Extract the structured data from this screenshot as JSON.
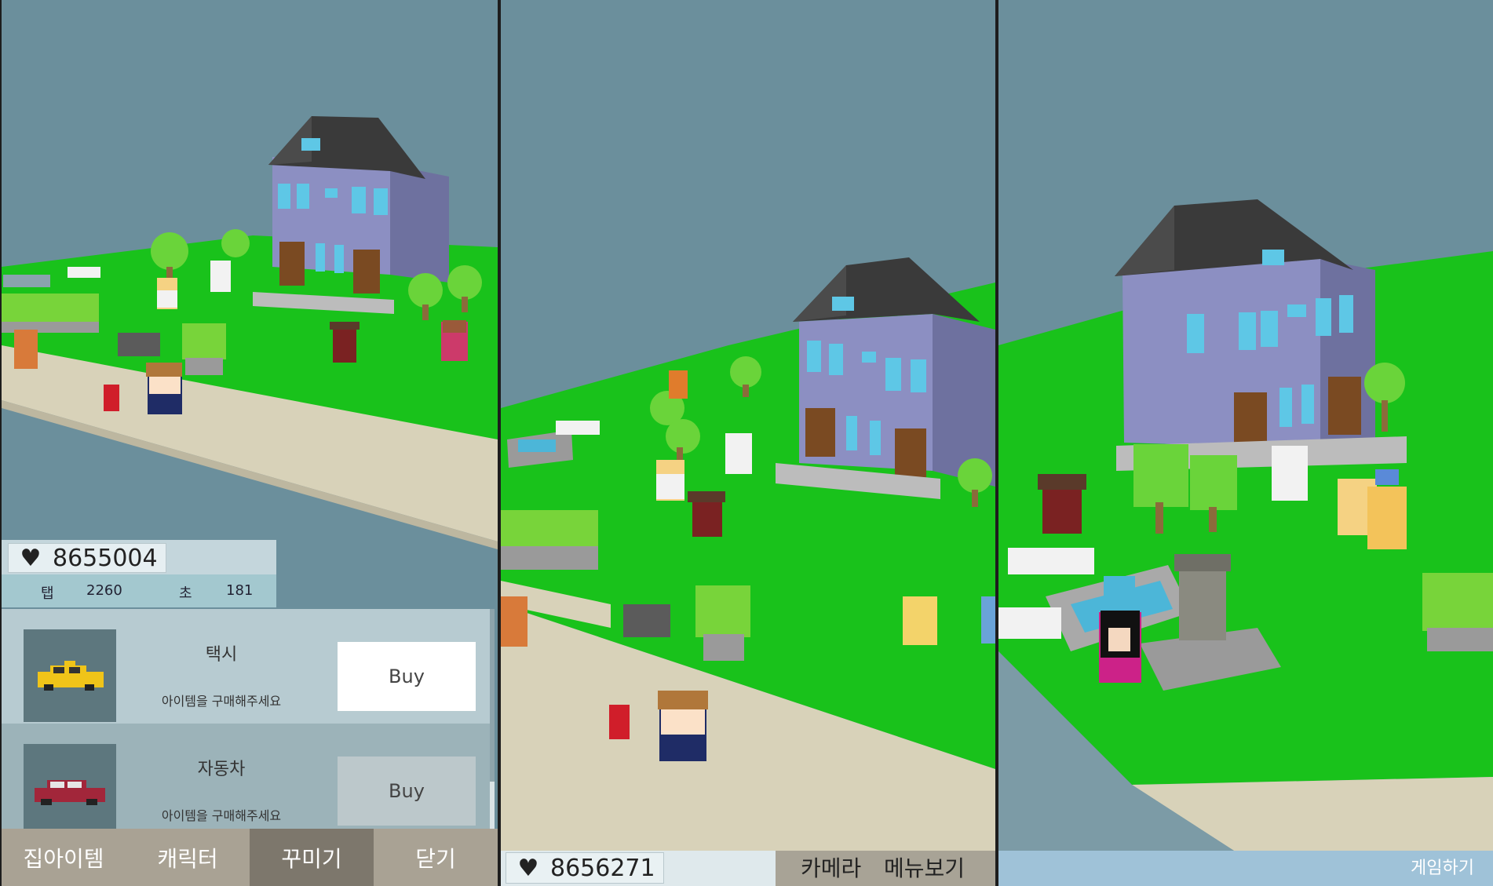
{
  "panel1": {
    "hearts": "8655004",
    "heart_icon": "♥",
    "stats": {
      "tap_label": "탭",
      "tap_value": "2260",
      "sec_label": "초",
      "sec_value": "181"
    },
    "shop_items": [
      {
        "name": "택시",
        "desc": "아이템을 구매해주세요",
        "buy": "Buy",
        "icon": "taxi-icon"
      },
      {
        "name": "자동차",
        "desc": "아이템을 구매해주세요",
        "buy": "Buy",
        "icon": "car-icon"
      }
    ],
    "tabs": [
      {
        "label": "집아이템"
      },
      {
        "label": "캐릭터"
      },
      {
        "label": "꾸미기"
      },
      {
        "label": "닫기"
      }
    ]
  },
  "panel2": {
    "hearts": "8656271",
    "heart_icon": "♥",
    "camera": "카메라",
    "menu": "메뉴보기"
  },
  "panel3": {
    "play": "게임하기"
  },
  "colors": {
    "sky": "#6b8f9c",
    "grass": "#18c818",
    "road": "#d7d1b8",
    "house": "#8c8fc2",
    "roof": "#3d3d3d"
  }
}
